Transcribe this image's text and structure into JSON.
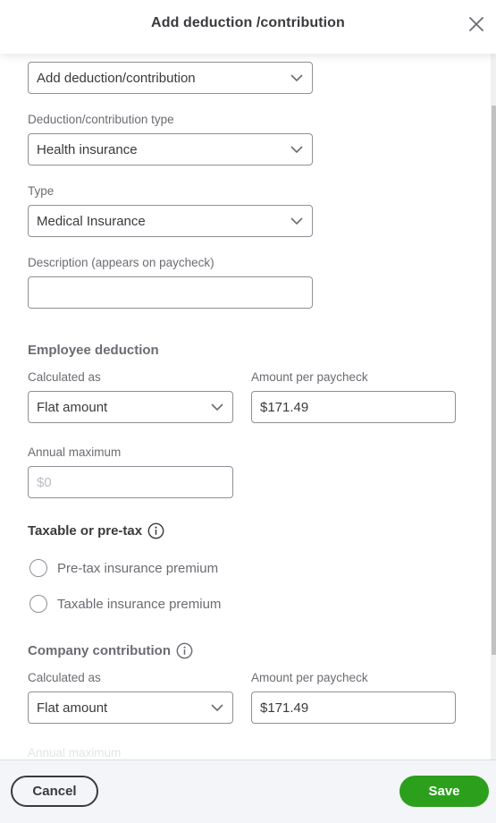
{
  "header": {
    "title": "Add deduction /contribution",
    "close_icon": "close-icon"
  },
  "form": {
    "add_select": {
      "value": "Add deduction/contribution"
    },
    "deduction_type": {
      "label": "Deduction/contribution type",
      "value": "Health insurance"
    },
    "type": {
      "label": "Type",
      "value": "Medical Insurance"
    },
    "description": {
      "label": "Description (appears on paycheck)",
      "value": ""
    },
    "employee_deduction": {
      "title": "Employee deduction",
      "calculated_as": {
        "label": "Calculated as",
        "value": "Flat amount"
      },
      "amount_per_paycheck": {
        "label": "Amount per paycheck",
        "value": "$171.49"
      },
      "annual_maximum": {
        "label": "Annual maximum",
        "placeholder": "$0"
      }
    },
    "taxable_or_pretax": {
      "title": "Taxable or pre-tax",
      "info_icon": "info-icon",
      "options": [
        {
          "label": "Pre-tax insurance premium",
          "selected": false
        },
        {
          "label": "Taxable insurance premium",
          "selected": false
        }
      ]
    },
    "company_contribution": {
      "title": "Company contribution",
      "info_icon": "info-icon",
      "calculated_as": {
        "label": "Calculated as",
        "value": "Flat amount"
      },
      "amount_per_paycheck": {
        "label": "Amount per paycheck",
        "value": "$171.49"
      },
      "annual_maximum": {
        "label": "Annual maximum"
      }
    }
  },
  "footer": {
    "cancel_label": "Cancel",
    "save_label": "Save"
  },
  "colors": {
    "primary_green": "#2ca01c",
    "text_dark": "#393a3d",
    "text_muted": "#6b6c72",
    "border": "#8d9096",
    "footer_bg": "#f4f5f8"
  }
}
